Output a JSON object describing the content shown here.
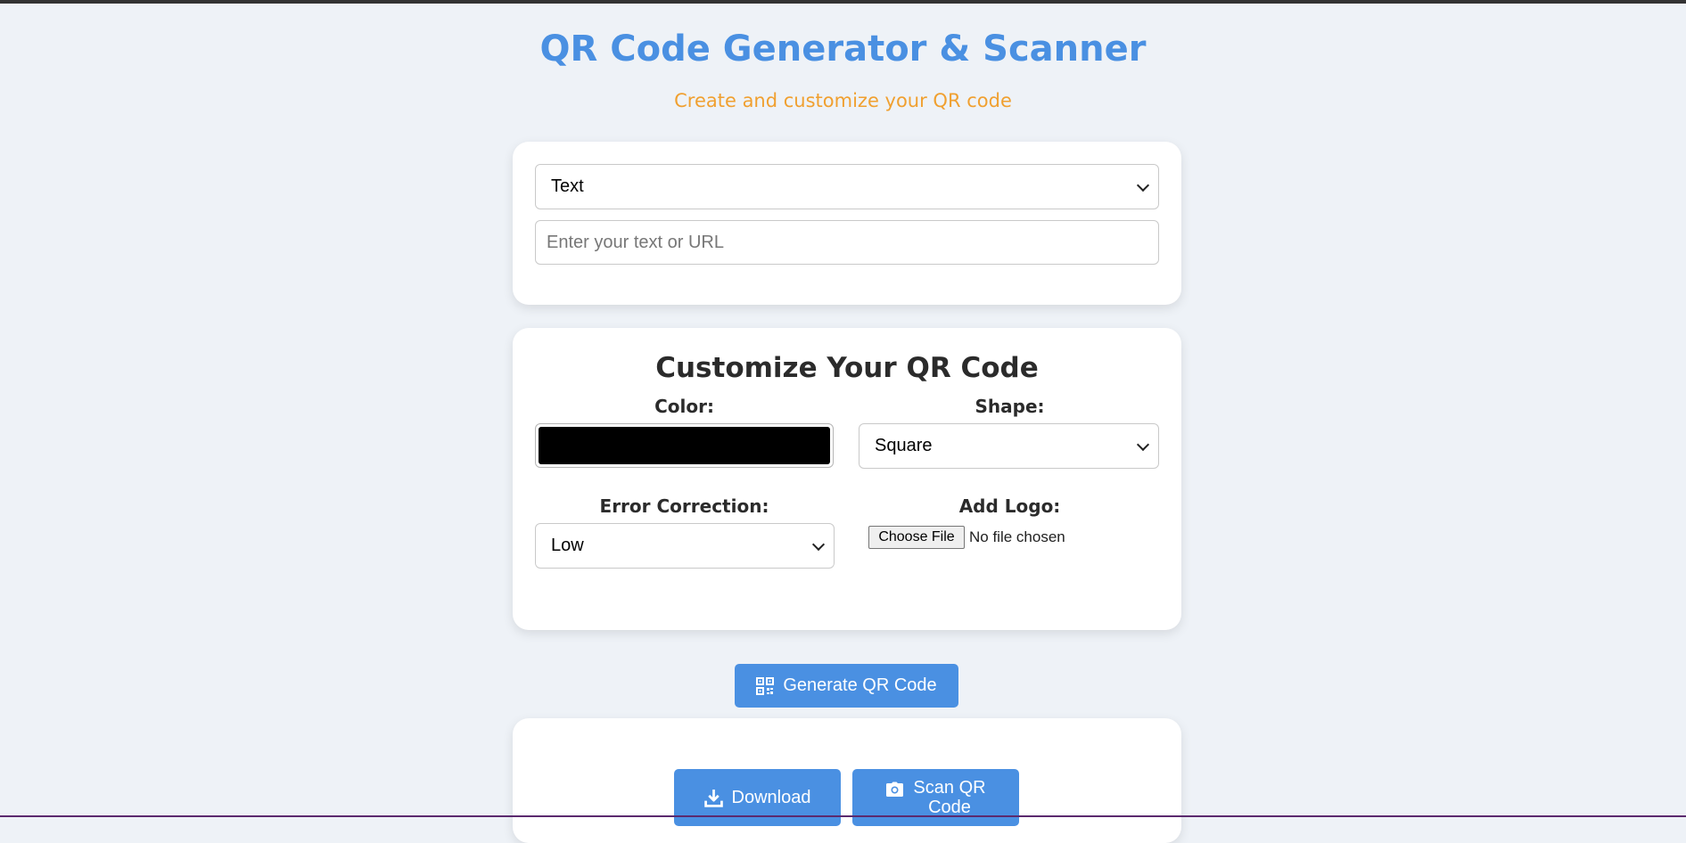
{
  "header": {
    "title": "QR Code Generator & Scanner",
    "subtitle": "Create and customize your QR code"
  },
  "input_card": {
    "type_select": {
      "selected": "Text"
    },
    "content_input": {
      "value": "",
      "placeholder": "Enter your text or URL"
    }
  },
  "customize": {
    "title": "Customize Your QR Code",
    "color": {
      "label": "Color:",
      "value": "#000000"
    },
    "shape": {
      "label": "Shape:",
      "selected": "Square"
    },
    "error_correction": {
      "label": "Error Correction:",
      "selected": "Low"
    },
    "logo": {
      "label": "Add Logo:",
      "button_label": "Choose File",
      "status": "No file chosen"
    }
  },
  "actions": {
    "generate_label": "Generate QR Code",
    "download_label": "Download",
    "scan_label_line1": "Scan QR",
    "scan_label_line2": "Code"
  },
  "icons": {
    "generate": "qrcode-icon",
    "download": "download-icon",
    "scan": "camera-icon"
  },
  "colors": {
    "accent": "#4a90e2",
    "subtitle": "#f0a030",
    "background": "#eef2f7",
    "heading": "#2b2b2b"
  }
}
